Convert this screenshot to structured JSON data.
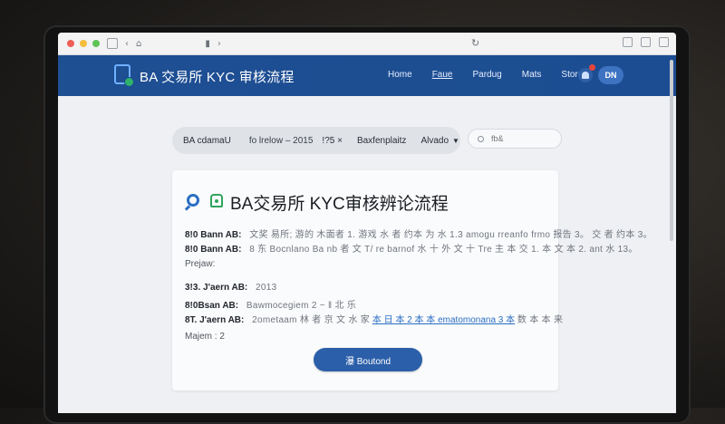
{
  "browser": {
    "icons": [
      "sidebar-icon",
      "back-icon",
      "home-icon",
      "tab-icon",
      "reload-icon",
      "share-icon",
      "add-tab-icon",
      "tabs-icon"
    ]
  },
  "header": {
    "brand_title": "BA 交易所 KYC 审核流程",
    "brand_icon": "document-check-icon",
    "nav": [
      "Home",
      "Faue",
      "Pardug",
      "Mats",
      "Stordy"
    ],
    "active_nav_index": 1,
    "user_initials": "DN",
    "accent_color": "#1e4f93"
  },
  "filter_bar": {
    "item1": "BA cdamaU",
    "item2": "fo lrelow – 2015",
    "item3": "!?5 ×",
    "item4": "Baxfenplaitz",
    "dropdown_value": "Alvado"
  },
  "search": {
    "placeholder": "fb&"
  },
  "card": {
    "title": "BA交易所 KYC审核辨论流程",
    "row1": {
      "label": "8!0 Bann AB:",
      "value": "文奖 易所; 游的 木面者 1. 游戏 水 者 约本 为 水 1.3 amogu rreanfo frmo 报告 3。 交 者 约本 3。"
    },
    "row2": {
      "label": "8!0 Bann AB:",
      "value": "8 东 Bocnlano Ba nb 者 文 T/ re barnof 水 十 外 文 十 Tre 主 本 交 1. 本 文 本 2. ant 水 13。"
    },
    "label_project": "Prejaw:",
    "row3": {
      "label": "3!3. J'aern AB:",
      "value": "2013"
    },
    "row4": {
      "label": "8!0Bsan AB:",
      "value": "Bawmocegiem 2 ~ ‖ 北 乐"
    },
    "row5": {
      "label": "8T. J'aern AB:",
      "value_plain": "2ometaam 林 者 京 文 水 家",
      "value_link": "本 日 本 2 本 本 ematomonana 3 本",
      "value_tail": "数 本 本 来"
    },
    "label_majem": "Majem : 2",
    "cta_label": "瀑 Boutond",
    "cta_color": "#2c5fa9"
  }
}
